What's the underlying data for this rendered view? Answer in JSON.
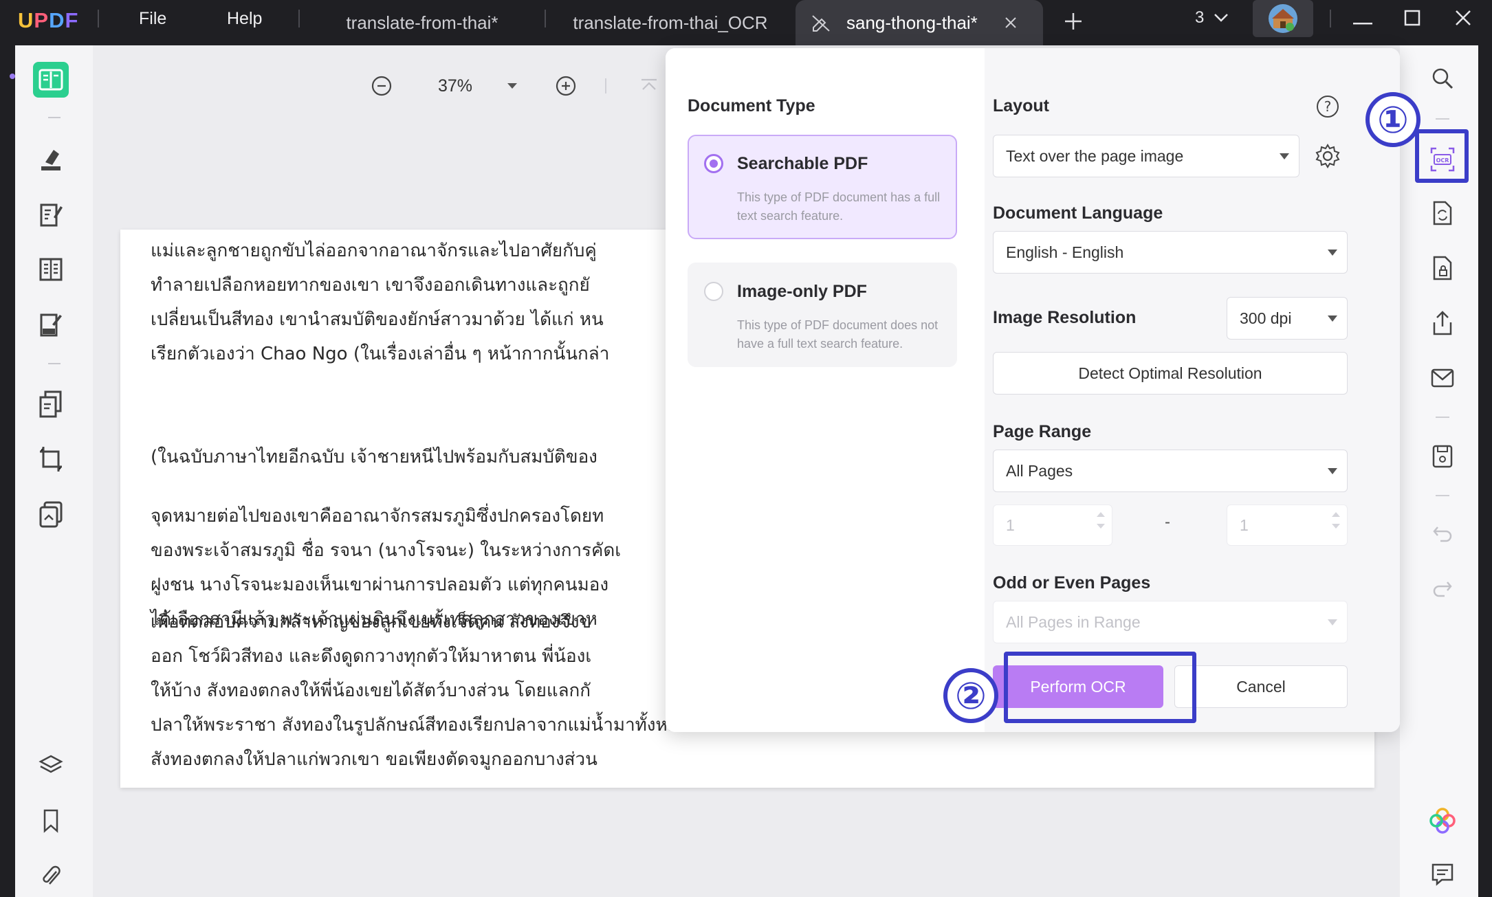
{
  "app": {
    "logo": [
      "U",
      "P",
      "D",
      "F"
    ],
    "menu": [
      "File",
      "Help"
    ],
    "tabs": [
      "translate-from-thai*",
      "translate-from-thai_OCR",
      "sang-thong-thai*"
    ],
    "tab_count": "3"
  },
  "toolbar": {
    "zoom": "37%"
  },
  "document": {
    "paragraphs": [
      [
        "แม่และลูกชายถูกขับไล่ออกจากอาณาจักรและไปอาศัยกับคู่",
        "ทำลายเปลือกหอยทากของเขา เขาจึงออกเดินทางและถูกยั",
        "เปลี่ยนเป็นสีทอง เขานำสมบัติของยักษ์สาวมาด้วย ได้แก่ หน",
        "เรียกตัวเองว่า Chao Ngo (ในเรื่องเล่าอื่น ๆ หน้ากากนั้นกล่า"
      ],
      [
        "(ในฉบับภาษาไทยอีกฉบับ เจ้าชายหนีไปพร้อมกับสมบัติของ"
      ],
      [
        "จุดหมายต่อไปของเขาคืออาณาจักรสมรภูมิซึ่งปกครองโดยท",
        "ของพระเจ้าสมรภูมิ ชื่อ รจนา (นางโรจนะ) ในระหว่างการคัดเ",
        "ฝูงชน นางโรจนะมองเห็นเขาผ่านการปลอมตัว แต่ทุกคนมอง",
        "ได้เลือกสามีแล้ว พระเจ้าแผ่นดินจึงเนรเทศลูกสาวของเขาห"
      ],
      [
        "เพื่อทดสอบความกล้าหาญของลูกเขยทั้งเจ็ดคน สังทองจึงข",
        "ออก โชว์ผิวสีทอง และดึงดูดกวางทุกตัวให้มาหาตน พี่น้องเ",
        "ให้บ้าง สังทองตกลงให้พี่น้องเขยได้สัตว์บางส่วน โดยแลกกั",
        "ปลาให้พระราชา สังทองในรูปลักษณ์สีทองเรียกปลาจากแม่น้ำมาทั้งหมด และพี่น้องเขยก็มาพบและขอปลาที่จับได้ เช่นเดียวกันกับคราวก่อน",
        "สังทองตกลงให้ปลาแก่พวกเขา ขอเพียงตัดจมูกออกบางส่วน"
      ]
    ]
  },
  "ocr": {
    "document_type_title": "Document Type",
    "options": [
      {
        "title": "Searchable PDF",
        "desc": "This type of PDF document has a full text search feature.",
        "selected": true
      },
      {
        "title": "Image-only PDF",
        "desc": "This type of PDF document does not have a full text search feature.",
        "selected": false
      }
    ],
    "layout_label": "Layout",
    "layout_value": "Text over the page image",
    "language_label": "Document Language",
    "language_value": "English - English",
    "resolution_label": "Image Resolution",
    "resolution_value": "300 dpi",
    "detect_button": "Detect Optimal Resolution",
    "page_range_label": "Page Range",
    "page_range_value": "All Pages",
    "range_from": "1",
    "range_dash": "-",
    "range_to": "1",
    "odd_even_label": "Odd or Even Pages",
    "odd_even_value": "All Pages in Range",
    "perform_button": "Perform OCR",
    "cancel_button": "Cancel"
  },
  "annotations": [
    "①",
    "②"
  ],
  "colors": {
    "accent": "#b97cf3",
    "active_tool": "#2bcf8f",
    "annotation": "#3b3dc8"
  }
}
